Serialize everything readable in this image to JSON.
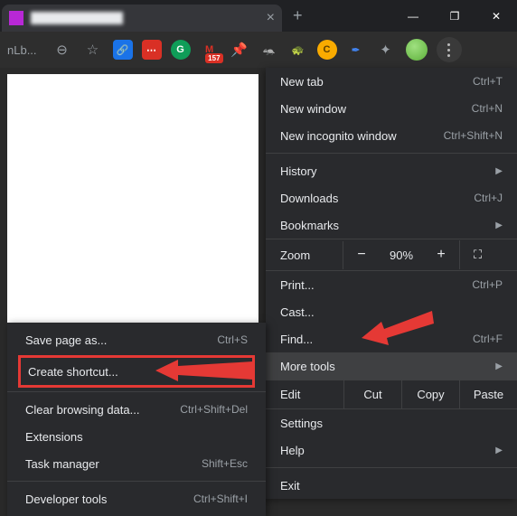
{
  "window": {
    "tab_title": "████████████",
    "minimize": "—",
    "maximize": "❐",
    "close": "✕"
  },
  "toolbar": {
    "address_fragment": "nLb...",
    "badge_count": "157"
  },
  "menu": {
    "new_tab": {
      "label": "New tab",
      "shortcut": "Ctrl+T"
    },
    "new_window": {
      "label": "New window",
      "shortcut": "Ctrl+N"
    },
    "new_incognito": {
      "label": "New incognito window",
      "shortcut": "Ctrl+Shift+N"
    },
    "history": {
      "label": "History"
    },
    "downloads": {
      "label": "Downloads",
      "shortcut": "Ctrl+J"
    },
    "bookmarks": {
      "label": "Bookmarks"
    },
    "zoom": {
      "label": "Zoom",
      "value": "90%"
    },
    "print": {
      "label": "Print...",
      "shortcut": "Ctrl+P"
    },
    "cast": {
      "label": "Cast..."
    },
    "find": {
      "label": "Find...",
      "shortcut": "Ctrl+F"
    },
    "more_tools": {
      "label": "More tools"
    },
    "edit": {
      "label": "Edit",
      "cut": "Cut",
      "copy": "Copy",
      "paste": "Paste"
    },
    "settings": {
      "label": "Settings"
    },
    "help": {
      "label": "Help"
    },
    "exit": {
      "label": "Exit"
    }
  },
  "submenu": {
    "save_page": {
      "label": "Save page as...",
      "shortcut": "Ctrl+S"
    },
    "create_shortcut": {
      "label": "Create shortcut..."
    },
    "clear_data": {
      "label": "Clear browsing data...",
      "shortcut": "Ctrl+Shift+Del"
    },
    "extensions": {
      "label": "Extensions"
    },
    "task_manager": {
      "label": "Task manager",
      "shortcut": "Shift+Esc"
    },
    "developer_tools": {
      "label": "Developer tools",
      "shortcut": "Ctrl+Shift+I"
    }
  }
}
